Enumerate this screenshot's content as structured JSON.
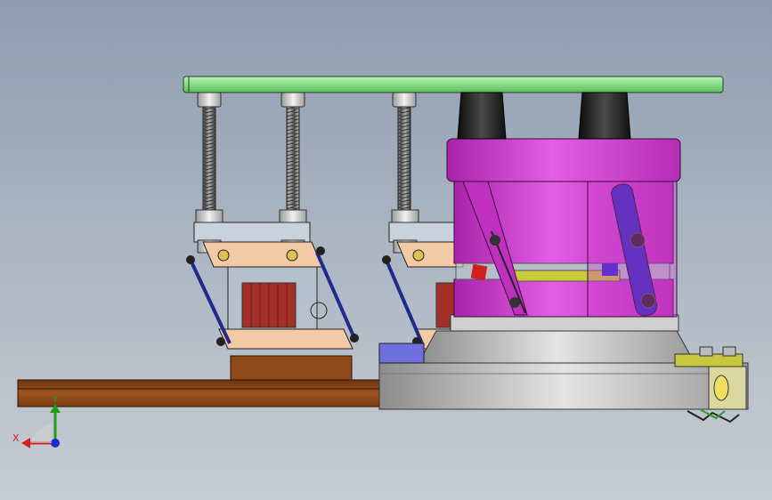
{
  "viewport": {
    "background": "#a4afbd"
  },
  "triad": {
    "x_label": "X",
    "y_label": "Y",
    "x_color": "#d42020",
    "y_color": "#1aa01a",
    "z_color": "#1a2ad4"
  },
  "colors": {
    "top_plate": "#8fe08f",
    "press_body": "#d13bd1",
    "press_body_light": "#e06ae0",
    "base_disc": "#b8b8b8",
    "wood_board": "#8b4513",
    "rods": "#6b6b6b",
    "caps": "#202020",
    "clamp_plate": "#f4c9a0",
    "insert_red": "#a0302a",
    "bracket_yellow": "#cccc44",
    "side_block_blue": "#7070e0"
  }
}
